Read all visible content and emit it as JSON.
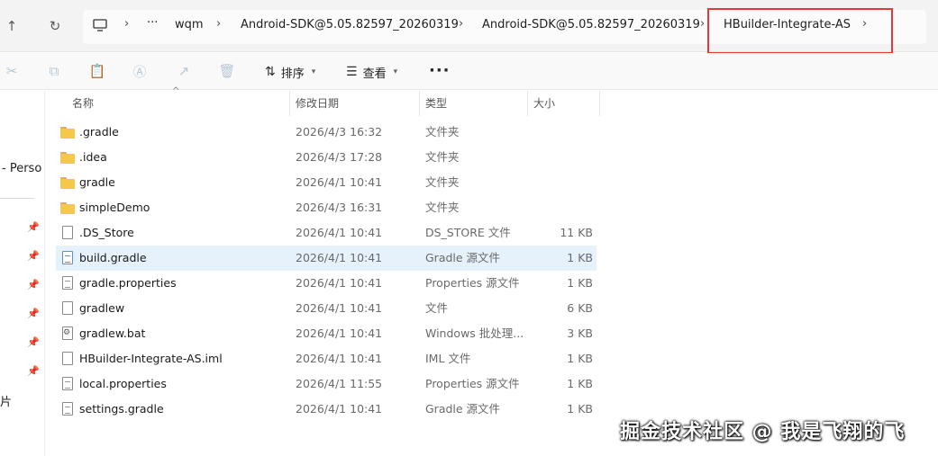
{
  "address_bar": {
    "crumbs": [
      "wqm",
      "Android-SDK@5.05.82597_20260319",
      "Android-SDK@5.05.82597_20260319",
      "HBuilder-Integrate-AS"
    ],
    "more": "···"
  },
  "toolbar": {
    "sort_label": "排序",
    "view_label": "查看",
    "more_label": "···"
  },
  "nav_pane": {
    "quick_access_label": "- Perso",
    "bottom_label": "片"
  },
  "columns": {
    "name": "名称",
    "date": "修改日期",
    "type": "类型",
    "size": "大小"
  },
  "files": [
    {
      "name": ".gradle",
      "date": "2026/4/3 16:32",
      "type": "文件夹",
      "size": "",
      "icon": "folder-icon"
    },
    {
      "name": ".idea",
      "date": "2026/4/3 17:28",
      "type": "文件夹",
      "size": "",
      "icon": "folder-icon"
    },
    {
      "name": "gradle",
      "date": "2026/4/1 10:41",
      "type": "文件夹",
      "size": "",
      "icon": "folder-icon"
    },
    {
      "name": "simpleDemo",
      "date": "2026/4/3 16:31",
      "type": "文件夹",
      "size": "",
      "icon": "folder-icon"
    },
    {
      "name": ".DS_Store",
      "date": "2026/4/1 10:41",
      "type": "DS_STORE 文件",
      "size": "11 KB",
      "icon": "file-icon"
    },
    {
      "name": "build.gradle",
      "date": "2026/4/1 10:41",
      "type": "Gradle 源文件",
      "size": "1 KB",
      "icon": "gradle-file-icon",
      "selected": true
    },
    {
      "name": "gradle.properties",
      "date": "2026/4/1 10:41",
      "type": "Properties 源文件",
      "size": "1 KB",
      "icon": "text-file-icon"
    },
    {
      "name": "gradlew",
      "date": "2026/4/1 10:41",
      "type": "文件",
      "size": "6 KB",
      "icon": "file-icon"
    },
    {
      "name": "gradlew.bat",
      "date": "2026/4/1 10:41",
      "type": "Windows 批处理...",
      "size": "3 KB",
      "icon": "batch-file-icon"
    },
    {
      "name": "HBuilder-Integrate-AS.iml",
      "date": "2026/4/1 10:41",
      "type": "IML 文件",
      "size": "1 KB",
      "icon": "file-icon"
    },
    {
      "name": "local.properties",
      "date": "2026/4/1 11:55",
      "type": "Properties 源文件",
      "size": "1 KB",
      "icon": "text-file-icon"
    },
    {
      "name": "settings.gradle",
      "date": "2026/4/1 10:41",
      "type": "Gradle 源文件",
      "size": "1 KB",
      "icon": "text-file-icon"
    }
  ],
  "watermark": "掘金技术社区 @ 我是飞翔的飞",
  "colors": {
    "selection": "#e5f1fb",
    "folder": "#f5c84a",
    "highlight_box": "#e53935"
  }
}
